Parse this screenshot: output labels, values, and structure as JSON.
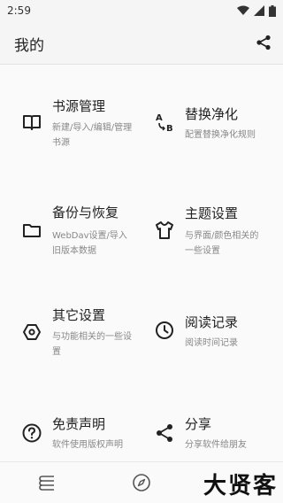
{
  "status": {
    "time": "2:59"
  },
  "appbar": {
    "title": "我的"
  },
  "items": [
    {
      "title": "书源管理",
      "desc": "新建/导入/编辑/管理书源",
      "icon": "book-icon"
    },
    {
      "title": "替换净化",
      "desc": "配置替换净化规则",
      "icon": "replace-ab-icon"
    },
    {
      "title": "备份与恢复",
      "desc": "WebDav设置/导入旧版本数据",
      "icon": "folder-icon"
    },
    {
      "title": "主题设置",
      "desc": "与界面/颜色相关的一些设置",
      "icon": "tshirt-icon"
    },
    {
      "title": "其它设置",
      "desc": "与功能相关的一些设置",
      "icon": "settings-hex-icon"
    },
    {
      "title": "阅读记录",
      "desc": "阅读时间记录",
      "icon": "clock-icon"
    },
    {
      "title": "免责声明",
      "desc": "软件使用版权声明",
      "icon": "help-circle-icon"
    },
    {
      "title": "分享",
      "desc": "分享软件给朋友",
      "icon": "share-icon"
    }
  ],
  "watermark": "大贤客"
}
